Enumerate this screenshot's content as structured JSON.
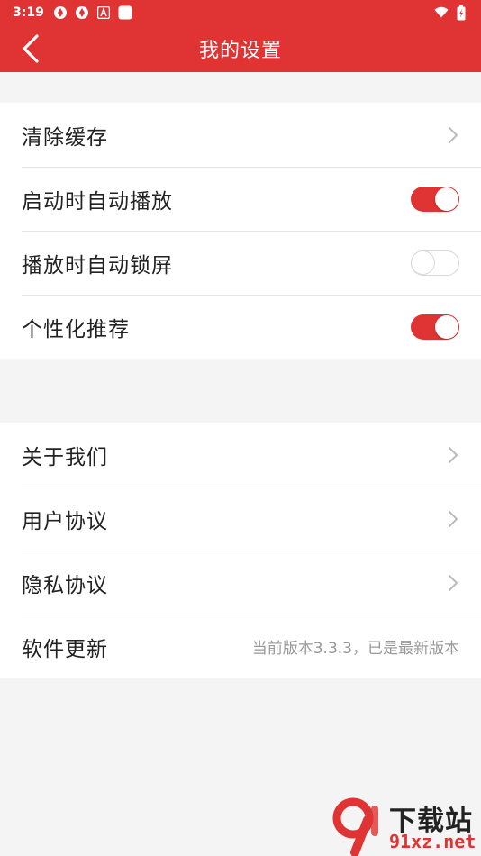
{
  "status_bar": {
    "time": "3:19",
    "left_icons": [
      "sync-icon",
      "sync-icon",
      "app-a-icon",
      "square-app-icon"
    ],
    "right_icons": [
      "wifi-icon",
      "battery-charging-icon"
    ]
  },
  "app_bar": {
    "title": "我的设置",
    "back_icon": "chevron-left-icon"
  },
  "group1": {
    "items": [
      {
        "label": "清除缓存",
        "control": "chevron"
      },
      {
        "label": "启动时自动播放",
        "control": "toggle",
        "on": true
      },
      {
        "label": "播放时自动锁屏",
        "control": "toggle",
        "on": false
      },
      {
        "label": "个性化推荐",
        "control": "toggle",
        "on": true
      }
    ]
  },
  "group2": {
    "items": [
      {
        "label": "关于我们",
        "control": "chevron"
      },
      {
        "label": "用户协议",
        "control": "chevron"
      },
      {
        "label": "隐私协议",
        "control": "chevron"
      },
      {
        "label": "软件更新",
        "value": "当前版本3.3.3，已是最新版本"
      }
    ]
  },
  "watermark": {
    "line1": "下载站",
    "line2": "91xz.net"
  },
  "colors": {
    "accent": "#e03434",
    "background": "#f4f4f4",
    "text": "#222222",
    "muted": "#999999"
  }
}
